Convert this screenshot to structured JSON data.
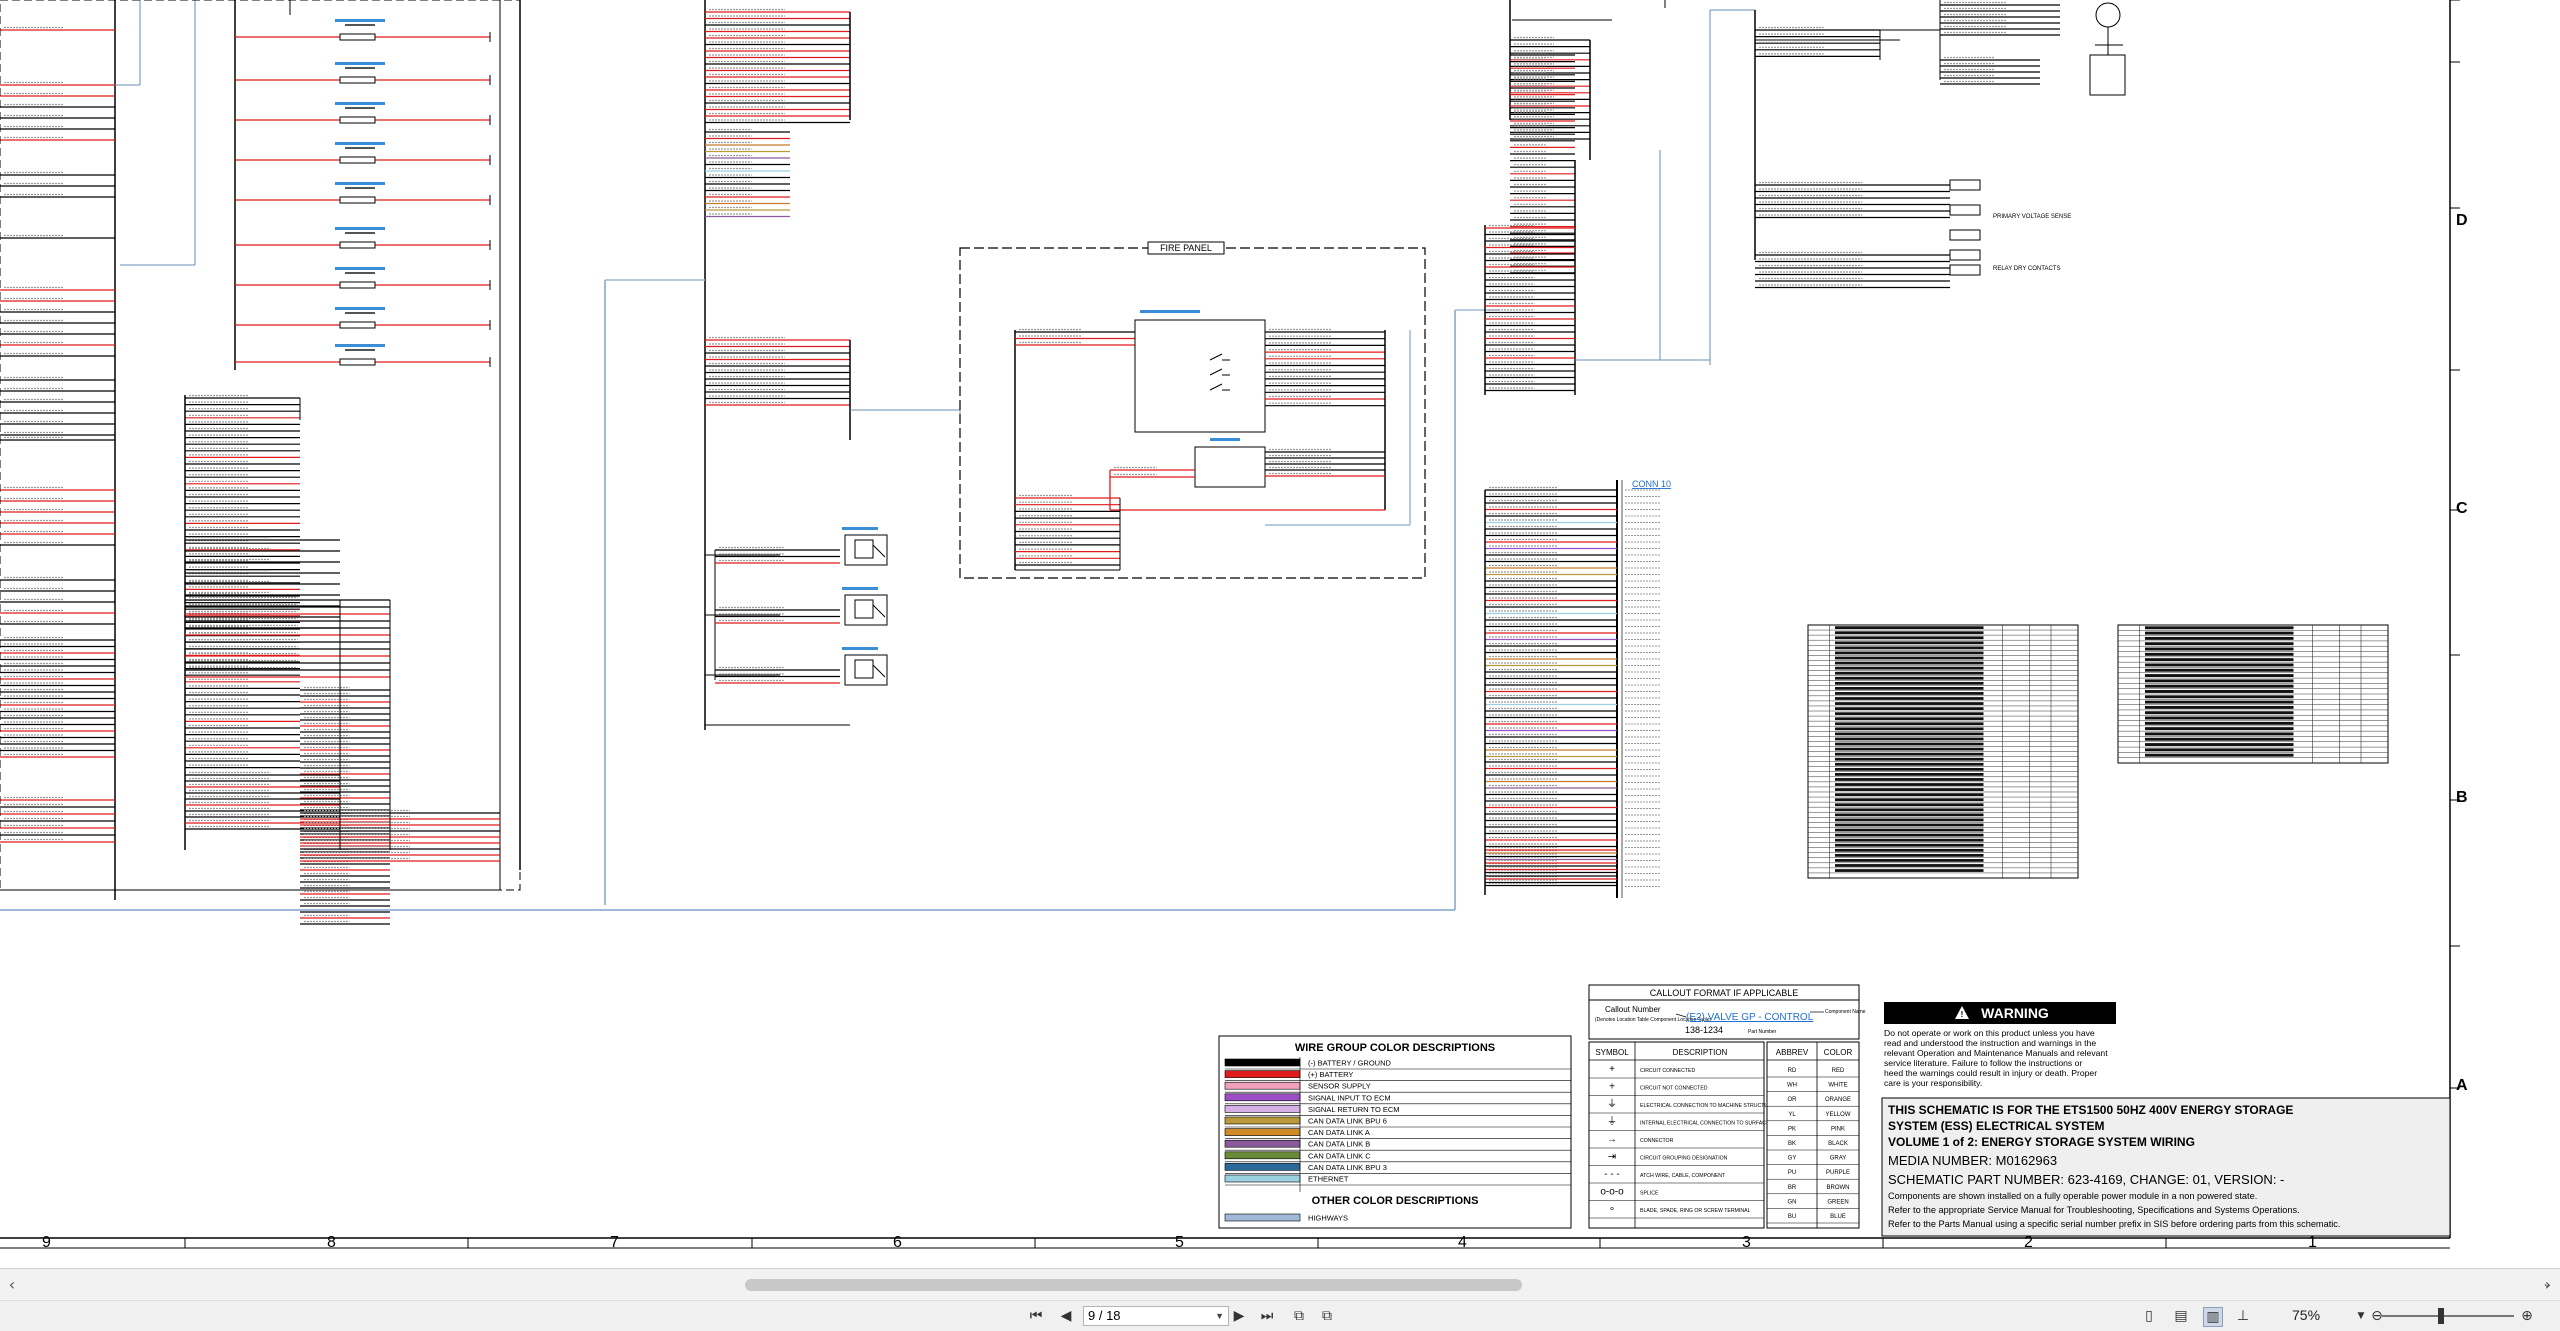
{
  "toolbar": {
    "page_current": "9",
    "page_total": "18",
    "page_display": "9 / 18",
    "zoom": "75%"
  },
  "icons": {
    "first_page": "first-page-icon",
    "prev_page": "prev-page-icon",
    "next_page": "next-page-icon",
    "last_page": "last-page-icon",
    "prev_view": "prev-view-icon",
    "next_view": "next-view-icon",
    "single_page": "single-page-icon",
    "continuous": "continuous-page-icon",
    "facing": "facing-page-icon",
    "cover": "cover-page-icon",
    "zoom_out": "zoom-out-icon",
    "zoom_in": "zoom-in-icon"
  },
  "schematic": {
    "fire_panel_title": "FIRE PANEL",
    "conn_label": "CONN 10",
    "primary_voltage": "PRIMARY VOLTAGE SENSE",
    "relay_dry": "RELAY DRY CONTACTS",
    "row_letters": [
      "D",
      "C",
      "B",
      "A"
    ],
    "column_numbers": [
      "9",
      "8",
      "7",
      "6",
      "5",
      "4",
      "3",
      "2",
      "1"
    ]
  },
  "wire_legend": {
    "title": "WIRE GROUP COLOR DESCRIPTIONS",
    "items": [
      {
        "label": "(-) BATTERY / GROUND",
        "color": "#000000"
      },
      {
        "label": "(+) BATTERY",
        "color": "#e01b1b"
      },
      {
        "label": "SENSOR SUPPLY",
        "color": "#f0a0b8"
      },
      {
        "label": "SIGNAL INPUT TO ECM",
        "color": "#9a4fc7"
      },
      {
        "label": "SIGNAL RETURN TO ECM",
        "color": "#d7b0e6"
      },
      {
        "label": "CAN DATA LINK BPU 6",
        "color": "#b89a3c"
      },
      {
        "label": "CAN DATA LINK A",
        "color": "#d08a2a"
      },
      {
        "label": "CAN DATA LINK B",
        "color": "#8a5a9a"
      },
      {
        "label": "CAN DATA LINK C",
        "color": "#6a8a3a"
      },
      {
        "label": "CAN DATA LINK BPU 3",
        "color": "#2a6a9a"
      },
      {
        "label": "ETHERNET",
        "color": "#9ad0e0"
      }
    ],
    "other_title": "OTHER COLOR DESCRIPTIONS",
    "other_items": [
      {
        "label": "HIGHWAYS",
        "color": "#9fb9d6"
      }
    ]
  },
  "callout": {
    "title": "CALLOUT FORMAT IF APPLICABLE",
    "callout_number": "Callout Number",
    "callout_sub": "(Denotes Location Table Component Location Table)",
    "example": "(E2) VALVE GP - CONTROL",
    "component_name": "Component Name",
    "part_number": "138-1234",
    "part_number_label": "Part Number"
  },
  "symbol_table": {
    "headers": [
      "SYMBOL",
      "DESCRIPTION"
    ],
    "rows": [
      {
        "symbol": "+",
        "desc": "CIRCUIT CONNECTED"
      },
      {
        "symbol": "+",
        "desc": "CIRCUIT NOT CONNECTED"
      },
      {
        "symbol": "⏚",
        "desc": "ELECTRICAL CONNECTION TO MACHINE STRUCTURE"
      },
      {
        "symbol": "⏚",
        "desc": "INTERNAL ELECTRICAL CONNECTION TO SURFACE OF COMPONENT"
      },
      {
        "symbol": "→",
        "desc": "CONNECTOR"
      },
      {
        "symbol": "⇥",
        "desc": "CIRCUIT GROUPING DESIGNATION"
      },
      {
        "symbol": "- - -",
        "desc": "ATCH WIRE, CABLE, COMPONENT"
      },
      {
        "symbol": "o-o-o",
        "desc": "SPLICE"
      },
      {
        "symbol": "∘",
        "desc": "BLADE, SPADE, RING OR SCREW TERMINAL"
      }
    ]
  },
  "abbrev_table": {
    "headers": [
      "ABBREV",
      "COLOR"
    ],
    "rows": [
      [
        "RD",
        "RED"
      ],
      [
        "WH",
        "WHITE"
      ],
      [
        "OR",
        "ORANGE"
      ],
      [
        "YL",
        "YELLOW"
      ],
      [
        "PK",
        "PINK"
      ],
      [
        "BK",
        "BLACK"
      ],
      [
        "GY",
        "GRAY"
      ],
      [
        "PU",
        "PURPLE"
      ],
      [
        "BR",
        "BROWN"
      ],
      [
        "GN",
        "GREEN"
      ],
      [
        "BU",
        "BLUE"
      ]
    ]
  },
  "warning": {
    "title": "WARNING",
    "text": "Do not operate or work on this product unless you have read and understood the instruction and warnings in the relevant Operation and Maintenance Manuals and relevant service literature. Failure to follow the instructions or heed the warnings could result in injury or death. Proper care is your responsibility."
  },
  "title_block": {
    "line1": "THIS SCHEMATIC IS FOR THE ETS1500 50HZ 400V ENERGY STORAGE",
    "line2": "SYSTEM (ESS) ELECTRICAL SYSTEM",
    "line3": "VOLUME 1 of 2: ENERGY STORAGE SYSTEM WIRING",
    "media": "MEDIA NUMBER: M0162963",
    "part": "SCHEMATIC PART NUMBER: 623-4169, CHANGE: 01, VERSION: -",
    "note1": "Components are shown installed on a fully operable power module in a non powered state.",
    "note2": "Refer to the appropriate Service Manual for Troubleshooting, Specifications and Systems Operations.",
    "note3": "Refer to the Parts Manual using a specific serial number prefix in SIS before ordering parts from this schematic."
  }
}
